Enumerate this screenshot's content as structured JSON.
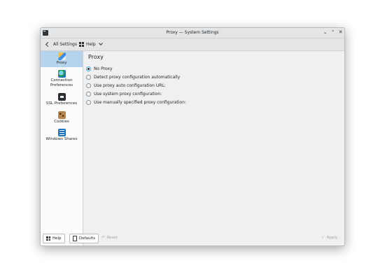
{
  "window": {
    "title": "Proxy — System Settings",
    "controls": [
      "minimize",
      "maximize",
      "close"
    ]
  },
  "toolbar": {
    "back_label": "All Settings",
    "help_label": "Help"
  },
  "sidebar": {
    "items": [
      {
        "label": "Proxy",
        "icon": "proxy-icon",
        "selected": true
      },
      {
        "label": "Connection Preferences",
        "icon": "globe-icon",
        "selected": false
      },
      {
        "label": "SSL Preferences",
        "icon": "certificate-icon",
        "selected": false
      },
      {
        "label": "Cookies",
        "icon": "cookie-icon",
        "selected": false
      },
      {
        "label": "Windows Shares",
        "icon": "network-share-icon",
        "selected": false
      }
    ]
  },
  "main": {
    "title": "Proxy",
    "options": [
      {
        "label": "No Proxy",
        "checked": true
      },
      {
        "label": "Detect proxy configuration automatically",
        "checked": false
      },
      {
        "label": "Use proxy auto configuration URL:",
        "checked": false
      },
      {
        "label": "Use system proxy configuration:",
        "checked": false
      },
      {
        "label": "Use manually specified proxy configuration:",
        "checked": false
      }
    ]
  },
  "footer": {
    "help_label": "Help",
    "defaults_label": "Defaults",
    "reset_label": "Reset",
    "apply_label": "Apply"
  },
  "colors": {
    "selection": "#b6d3ee",
    "focus": "#3daee9",
    "window_bg": "#eff0f1"
  }
}
